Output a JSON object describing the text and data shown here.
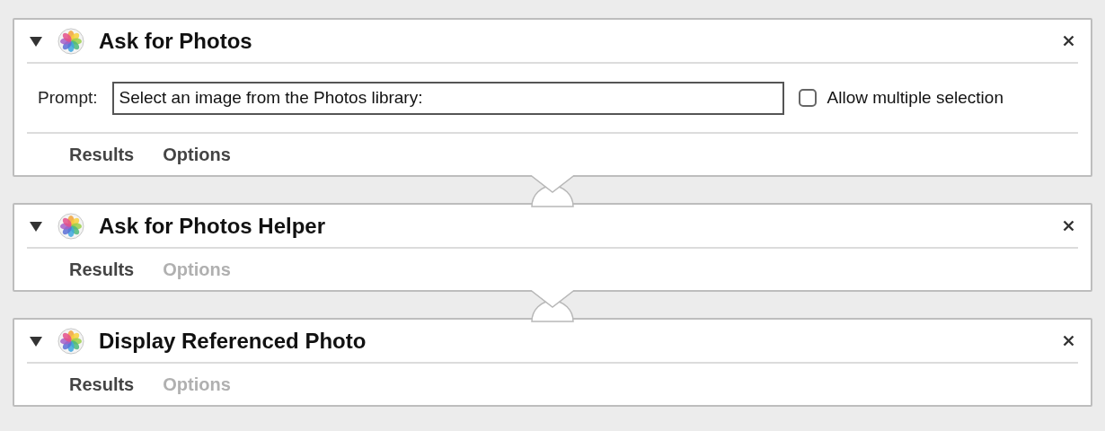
{
  "actions": [
    {
      "title": "Ask for Photos",
      "expanded": true,
      "prompt": {
        "label": "Prompt:",
        "value": "Select an image from the Photos library:"
      },
      "checkbox": {
        "label": "Allow multiple selection",
        "checked": false
      },
      "tabs": [
        {
          "label": "Results",
          "disabled": false
        },
        {
          "label": "Options",
          "disabled": false
        }
      ]
    },
    {
      "title": "Ask for Photos Helper",
      "expanded": true,
      "tabs": [
        {
          "label": "Results",
          "disabled": false
        },
        {
          "label": "Options",
          "disabled": true
        }
      ]
    },
    {
      "title": "Display Referenced Photo",
      "expanded": true,
      "tabs": [
        {
          "label": "Results",
          "disabled": false
        },
        {
          "label": "Options",
          "disabled": true
        }
      ]
    }
  ]
}
